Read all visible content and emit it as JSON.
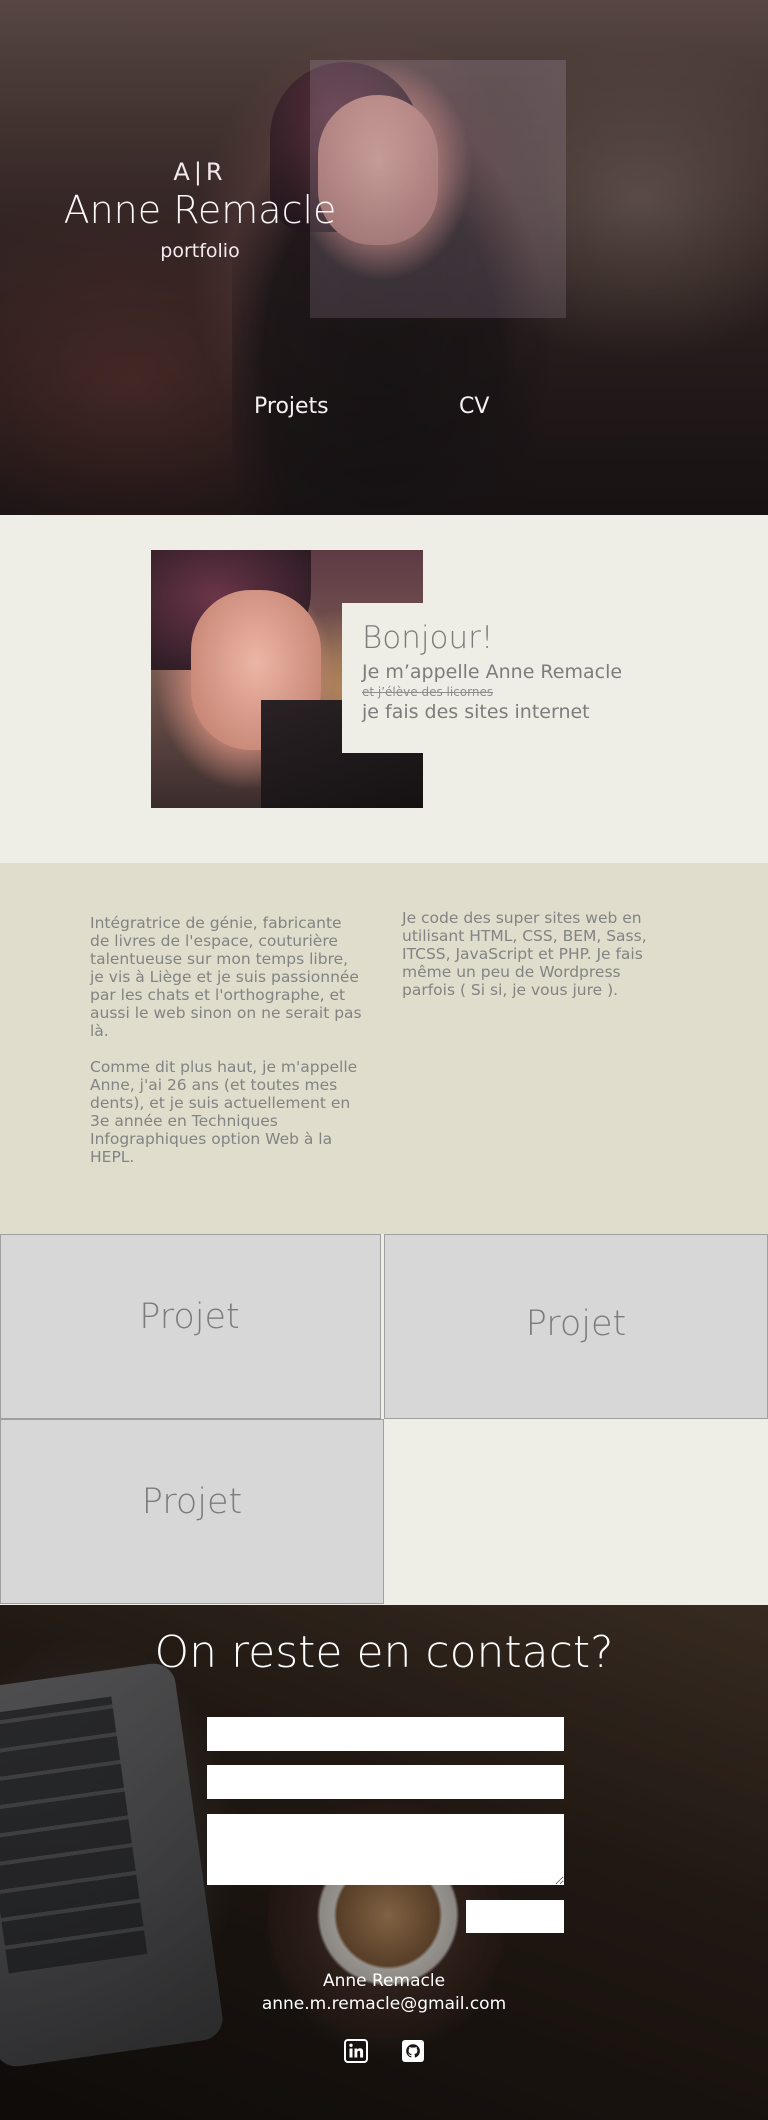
{
  "hero": {
    "logo_mark": "A|R",
    "name": "Anne Remacle",
    "subtitle": "portfolio",
    "nav": [
      {
        "label": "Projets"
      },
      {
        "label": "CV"
      }
    ]
  },
  "intro": {
    "greeting": "Bonjour!",
    "line1": "Je m’appelle Anne Remacle",
    "strike": "et j’élève des licornes",
    "line2": "je fais des sites internet"
  },
  "about": {
    "left": [
      "Intégratrice de génie, fabricante de livres de l'espace, couturière talentueuse sur mon temps libre, je vis à Liège et je suis passionnée par les chats et l'orthographe, et aussi le web sinon on ne serait pas là.",
      "Comme dit plus haut, je m'appelle Anne, j'ai 26 ans (et toutes mes dents), et je suis actuellement en 3e année en Techniques Infographiques option Web à la HEPL."
    ],
    "right": "Je code des super sites web en utilisant HTML, CSS, BEM, Sass, ITCSS, JavaScript et PHP. Je fais même un peu de Wordpress parfois ( Si si, je vous jure )."
  },
  "projects": [
    {
      "label": "Projet"
    },
    {
      "label": "Projet"
    },
    {
      "label": "Projet"
    }
  ],
  "contact": {
    "title": "On reste en contact?",
    "name": "Anne Remacle",
    "email": "anne.m.remacle@gmail.com",
    "social": [
      {
        "icon": "linkedin-icon"
      },
      {
        "icon": "github-icon"
      }
    ]
  }
}
